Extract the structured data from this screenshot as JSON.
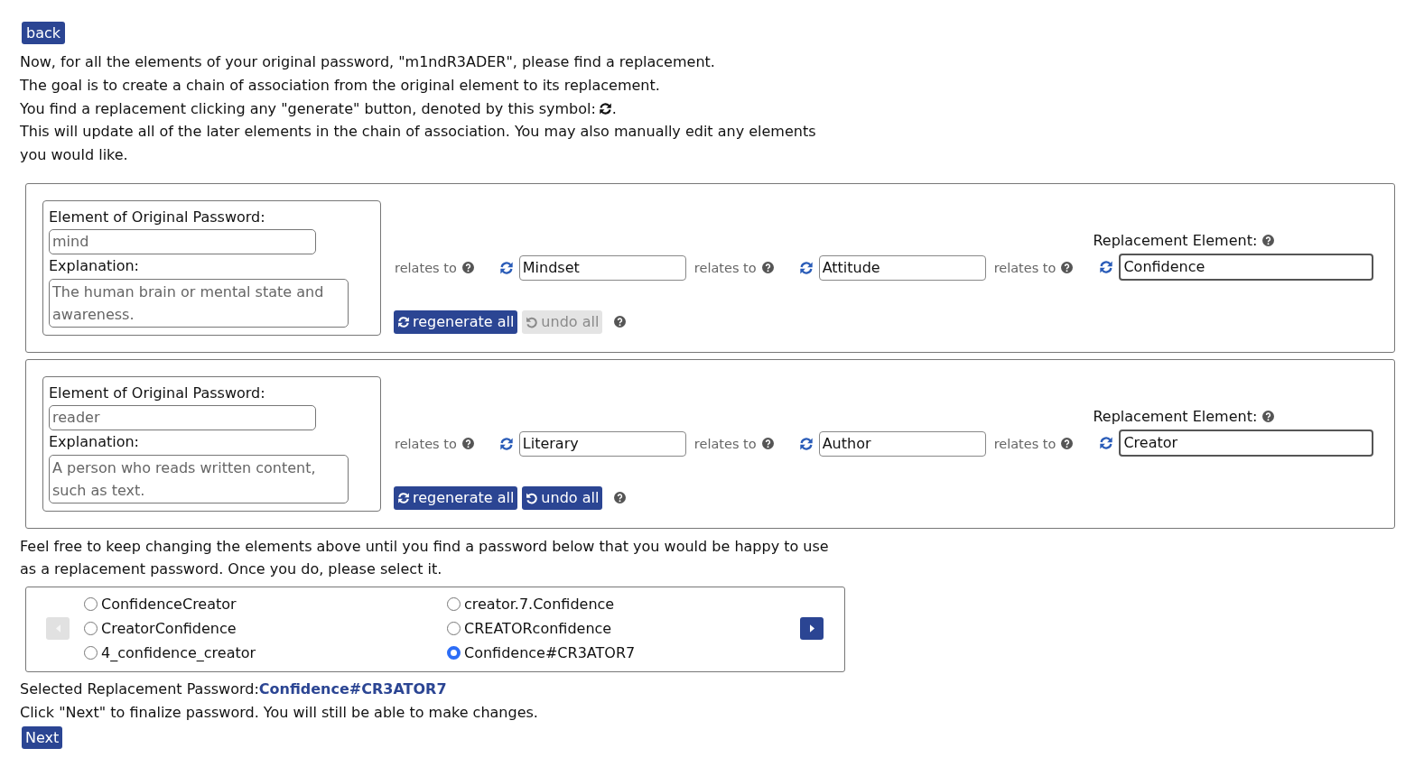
{
  "back_button": "back",
  "intro": [
    {
      "kind": "plain",
      "text": "Now, for all the elements of your original password, \"m1ndR3ADER\", please find a replacement."
    },
    {
      "kind": "plain",
      "text": "The goal is to create a chain of association from the original element to its replacement."
    },
    {
      "kind": "symbol",
      "text": "You find a replacement clicking any \"generate\" button, denoted by this symbol:",
      "after": "."
    },
    {
      "kind": "plain",
      "text": "This will update all of the later elements in the chain of association. You may also manually edit any elements you would like."
    }
  ],
  "elements": [
    {
      "original_label": "Element of Original Password:",
      "original": {
        "value": "mind",
        "disabled": true
      },
      "explanation_label": "Explanation:",
      "explanation": {
        "value": "The human brain or mental state and awareness.",
        "disabled": true
      },
      "chain": [
        {
          "relation": "relates to",
          "value": "Mindset"
        },
        {
          "relation": "relates to",
          "value": "Attitude"
        }
      ],
      "replacement": {
        "relation": "relates to",
        "label": "Replacement Element:",
        "value": "Confidence"
      },
      "regenerate_button": "regenerate all",
      "undo": {
        "label": "undo all",
        "disabled": true
      }
    },
    {
      "original_label": "Element of Original Password:",
      "original": {
        "value": "reader",
        "disabled": true
      },
      "explanation_label": "Explanation:",
      "explanation": {
        "value": "A person who reads written content, such as text.",
        "disabled": true
      },
      "chain": [
        {
          "relation": "relates to",
          "value": "Literary"
        },
        {
          "relation": "relates to",
          "value": "Author"
        }
      ],
      "replacement": {
        "relation": "relates to",
        "label": "Replacement Element:",
        "value": "Creator"
      },
      "regenerate_button": "regenerate all",
      "undo": {
        "label": "undo all",
        "disabled": false
      }
    }
  ],
  "instructions": "Feel free to keep changing the elements above until you find a password below that you would be happy to use as a replacement password. Once you do, please select it.",
  "pager": [
    {
      "kind": "prev",
      "disabled": true
    },
    {
      "kind": "next",
      "disabled": false
    }
  ],
  "options": [
    {
      "label": "ConfidenceCreator",
      "selected": false
    },
    {
      "label": "CreatorConfidence",
      "selected": false
    },
    {
      "label": "4_confidence_creator",
      "selected": false
    },
    {
      "label": "creator.7.Confidence",
      "selected": false
    },
    {
      "label": "CREATORconfidence",
      "selected": false
    },
    {
      "label": "Confidence#CR3ATOR7",
      "selected": true
    }
  ],
  "selected_label": "Selected Replacement Password:",
  "selected_value": "Confidence#CR3ATOR7",
  "final_note": "Click \"Next\" to finalize password. You will still be able to make changes.",
  "next_button": "Next"
}
